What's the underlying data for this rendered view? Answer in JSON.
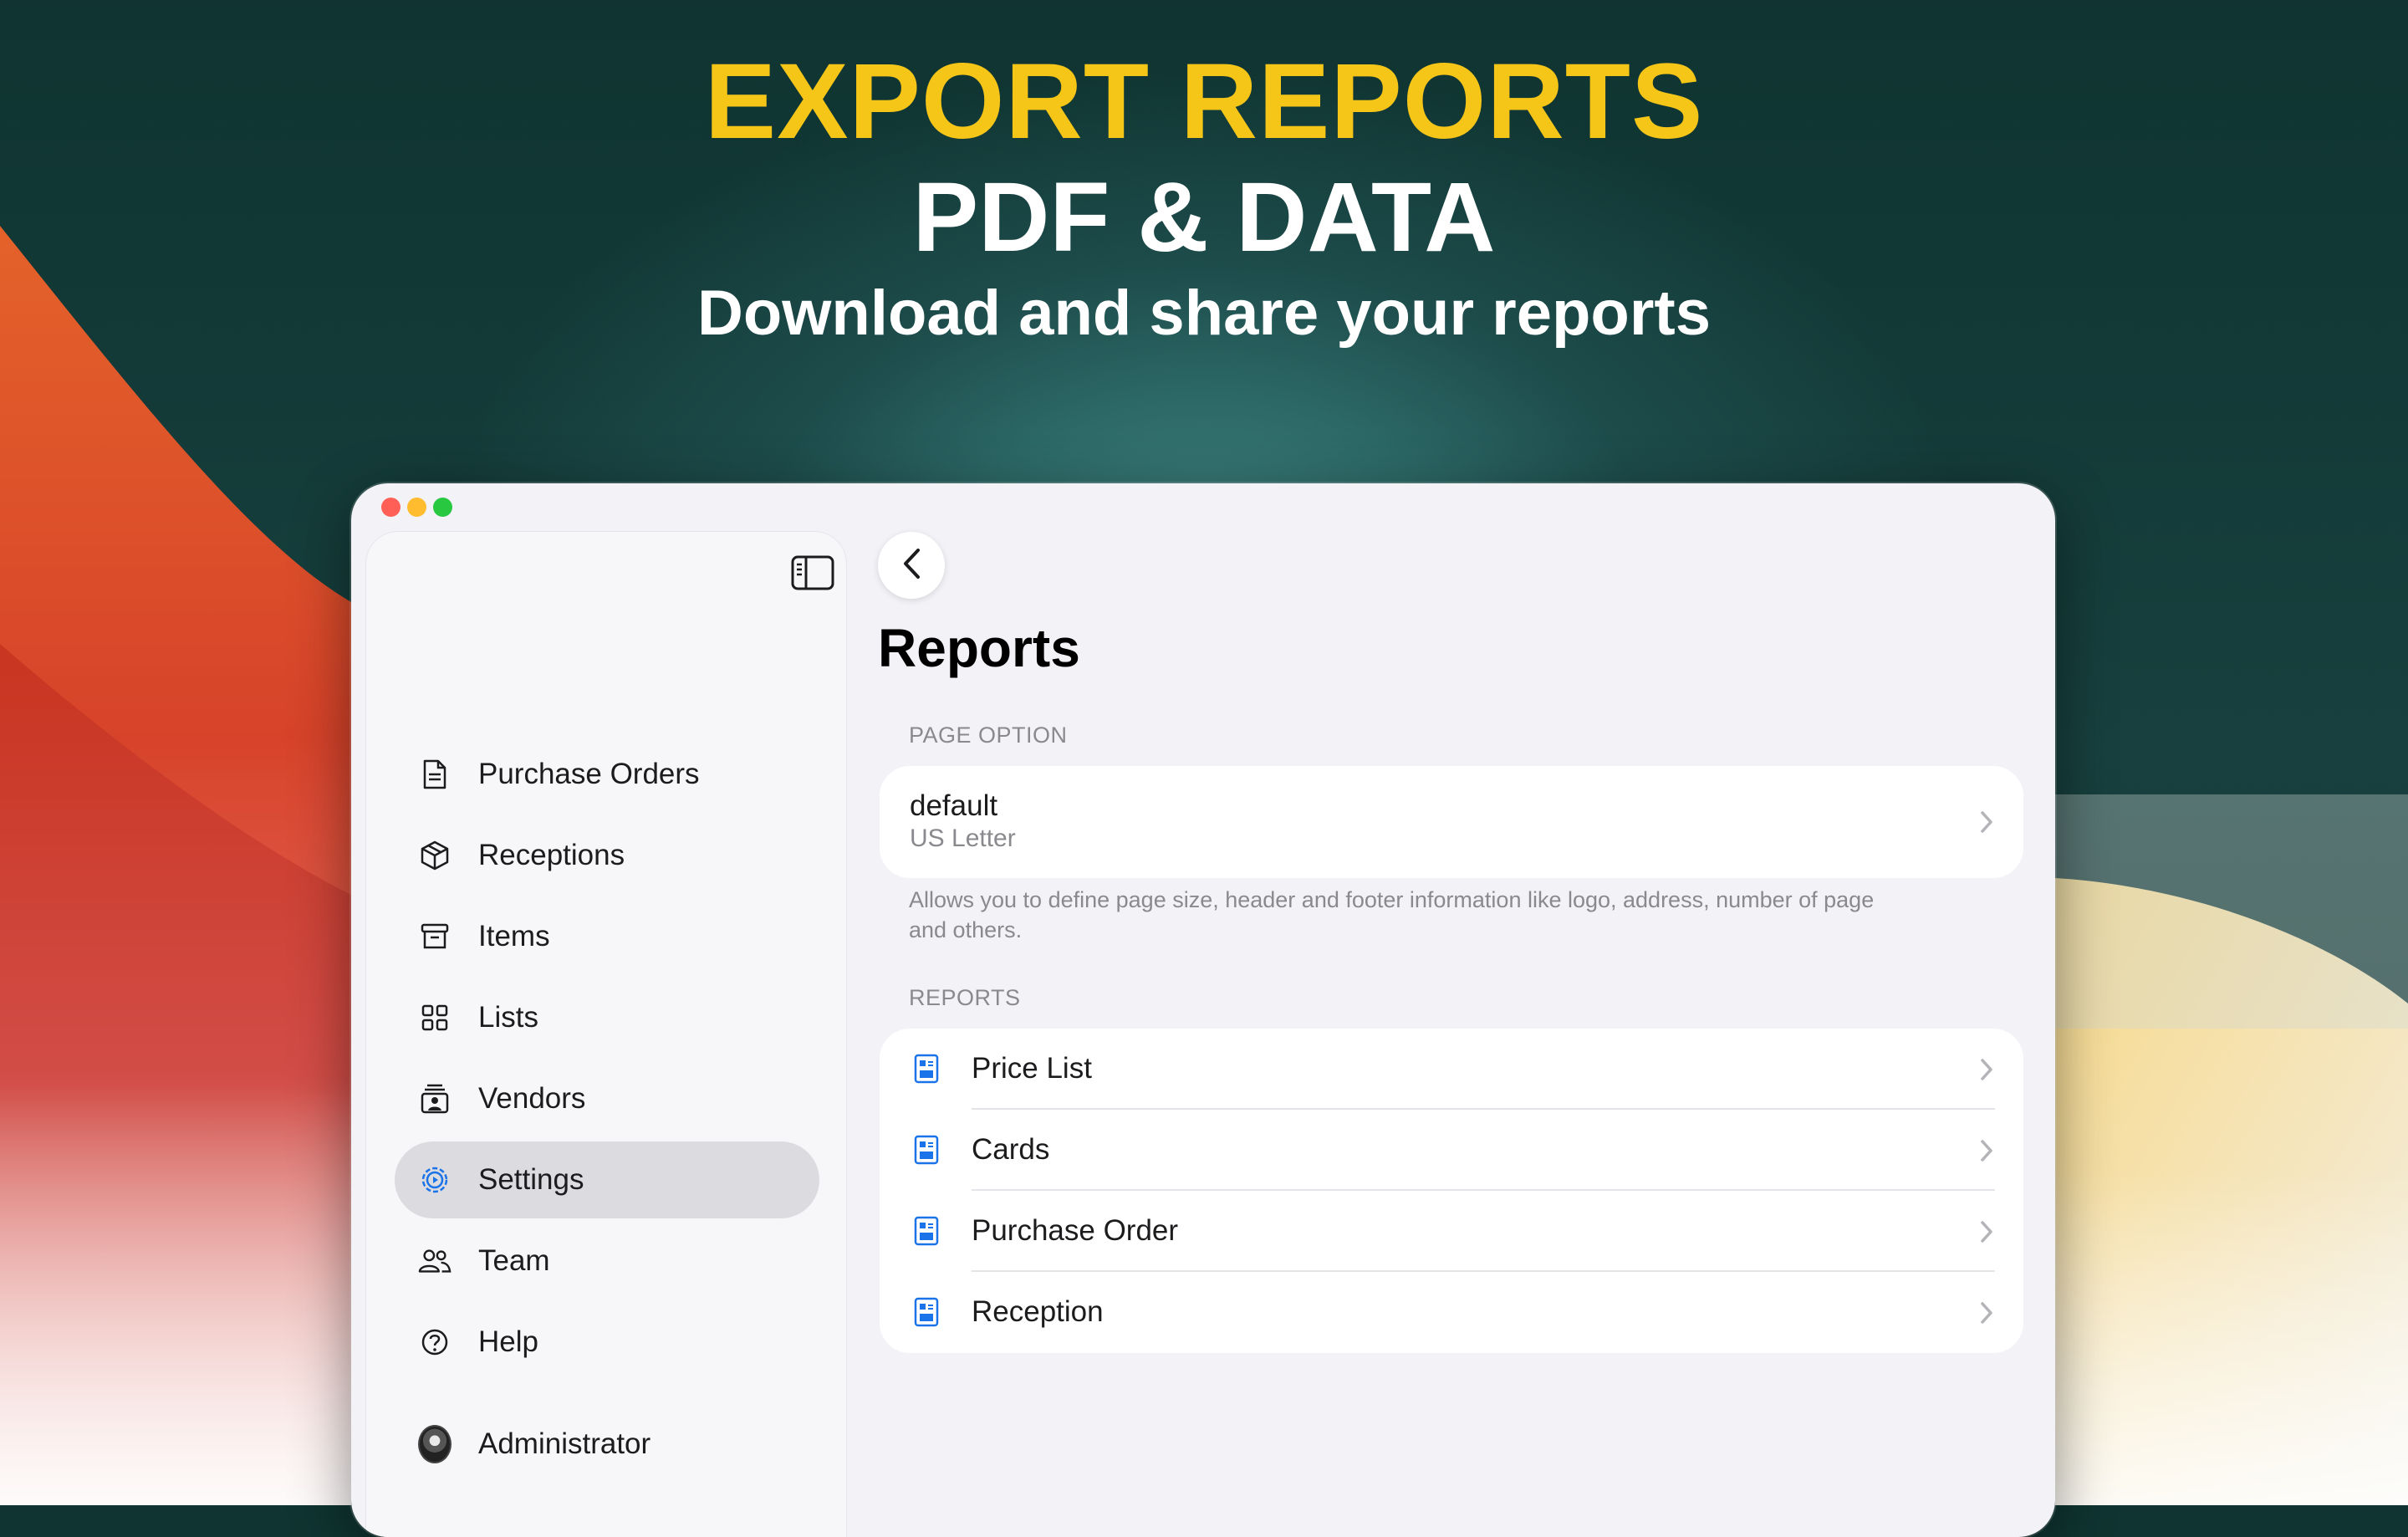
{
  "promo": {
    "headline": "EXPORT REPORTS",
    "subheadline": "PDF & DATA",
    "tagline": "Download and share your reports",
    "accent_color": "#f5c518"
  },
  "window": {
    "controls": [
      "close",
      "minimize",
      "maximize"
    ]
  },
  "sidebar": {
    "toggle_icon": "sidebar-toggle-icon",
    "items": [
      {
        "label": "Purchase Orders",
        "icon": "document-icon",
        "active": false
      },
      {
        "label": "Receptions",
        "icon": "box-icon",
        "active": false
      },
      {
        "label": "Items",
        "icon": "archive-icon",
        "active": false
      },
      {
        "label": "Lists",
        "icon": "grid-icon",
        "active": false
      },
      {
        "label": "Vendors",
        "icon": "contact-card-icon",
        "active": false
      },
      {
        "label": "Settings",
        "icon": "gear-icon",
        "active": true
      },
      {
        "label": "Team",
        "icon": "people-icon",
        "active": false
      },
      {
        "label": "Help",
        "icon": "question-icon",
        "active": false
      }
    ],
    "user": {
      "label": "Administrator",
      "icon": "avatar"
    }
  },
  "main": {
    "title": "Reports",
    "page_option": {
      "header": "PAGE OPTION",
      "title": "default",
      "subtitle": "US Letter",
      "footnote": "Allows you to define page size, header and footer information like logo, address, number of page and others."
    },
    "reports": {
      "header": "REPORTS",
      "items": [
        "Price List",
        "Cards",
        "Purchase Order",
        "Reception"
      ]
    },
    "accent_color": "#1a73e8"
  }
}
